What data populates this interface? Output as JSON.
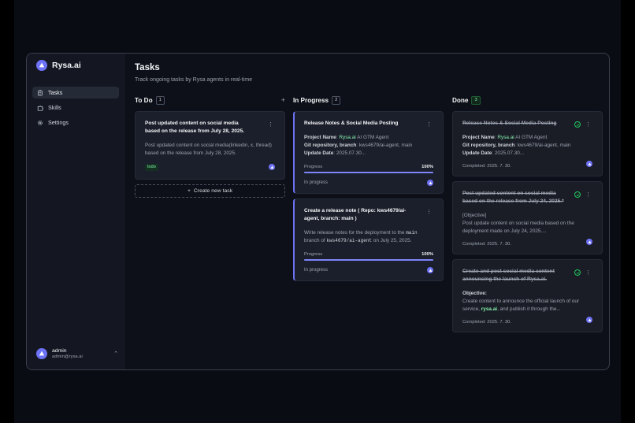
{
  "app": {
    "name": "Rysa.ai",
    "accent": "#6d72f6"
  },
  "sidebar": {
    "items": [
      {
        "label": "Tasks",
        "icon": "clipboard-icon",
        "active": true
      },
      {
        "label": "Skills",
        "icon": "puzzle-icon",
        "active": false
      },
      {
        "label": "Settings",
        "icon": "gear-icon",
        "active": false
      }
    ]
  },
  "user": {
    "name": "admin",
    "email": "admin@rysa.ai"
  },
  "page": {
    "title": "Tasks",
    "subtitle": "Track ongoing tasks by Rysa agents in real-time"
  },
  "columns": {
    "todo": {
      "title": "To Do",
      "count": "1",
      "create_label": "Create new task",
      "cards": [
        {
          "title": "Post updated content on social media based on the release from July 28, 2025.",
          "body": "Post updated content on social media(linkedin, x, thread) based on the release from July 28, 2025.",
          "badge": "todo"
        }
      ]
    },
    "progress": {
      "title": "In Progress",
      "count": "2",
      "cards": [
        {
          "title": "Release Notes & Social Media Posting",
          "project_key": "Project Name",
          "project_sep": ": ",
          "project_hl": "Rysa.ai",
          "project_rest": " AI GTM Agent",
          "repo_key": "Git repository, branch",
          "repo_val": ": kws4679/ai-agent, main",
          "date_key": "Update Date",
          "date_val": ": 2025.07.30...",
          "progress_label": "Progress",
          "progress_pct": "100%",
          "progress_value": 1.0,
          "status": "In progress"
        },
        {
          "title": "Create a release note ( Repo: kws4679/ai-agent, branch: main )",
          "body_a": "Write release notes for the deployment to the ",
          "body_code1": "main",
          "body_b": " branch of ",
          "body_code2": "kws4679/ai-agent",
          "body_c": " on July 25, 2025.",
          "progress_label": "Progress",
          "progress_pct": "100%",
          "progress_value": 1.0,
          "status": "In progress"
        }
      ]
    },
    "done": {
      "title": "Done",
      "count": "3",
      "cards": [
        {
          "title": "Release Notes & Social Media Posting",
          "project_key": "Project Name",
          "project_sep": ": ",
          "project_hl": "Rysa.ai",
          "project_rest": " AI GTM Agent",
          "repo_key": "Git repository, branch",
          "repo_val": ": kws4679/ai-agent, main",
          "date_key": "Update Date",
          "date_val": ": 2025.07.30...",
          "completed": "Completed: 2025. 7. 30."
        },
        {
          "title": "Post updated content on social media based on the release from July 24, 2025.*",
          "line1": "[Objective]",
          "line2": "Post update content on social media based on the deployment made on July 24, 2025....",
          "completed": "Completed: 2025. 7. 30."
        },
        {
          "title": "Create and post social media content announcing the launch of Rysa.ai.",
          "obj_key": "Objective:",
          "line_a": "Create content to announce the official launch of our service, ",
          "line_hl": "rysa.ai",
          "line_b": ", and publish it through the...",
          "completed": "Completed: 2025. 7. 30."
        }
      ]
    }
  }
}
